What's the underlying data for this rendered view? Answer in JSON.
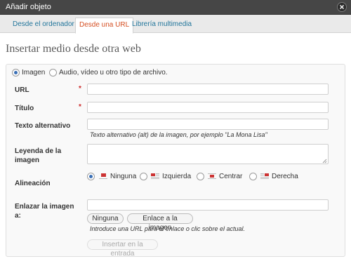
{
  "window": {
    "title": "Añadir objeto"
  },
  "tabs": [
    {
      "label": "Desde el ordenador",
      "active": false
    },
    {
      "label": "Desde una URL",
      "active": true
    },
    {
      "label": "Librería multimedia",
      "active": false
    }
  ],
  "heading": "Insertar medio desde otra web",
  "media_type": {
    "options": [
      "Imagen",
      "Audio, vídeo u otro tipo de archivo."
    ],
    "selected": "Imagen"
  },
  "fields": {
    "url": {
      "label": "URL",
      "required_mark": "*",
      "value": ""
    },
    "titulo": {
      "label": "Título",
      "required_mark": "*",
      "value": ""
    },
    "alt": {
      "label": "Texto alternativo",
      "value": "",
      "help": "Texto alternativo (alt) de la imagen, por ejemplo \"La Mona Lisa\""
    },
    "caption": {
      "label_line1": "Leyenda de la",
      "label_line2": "imagen",
      "value": ""
    },
    "align": {
      "label": "Alineación",
      "options": [
        "Ninguna",
        "Izquierda",
        "Centrar",
        "Derecha"
      ],
      "selected": "Ninguna"
    },
    "link": {
      "label_line1": "Enlazar la imagen",
      "label_line2": "a:",
      "value": "",
      "buttons": [
        "Ninguna",
        "Enlace a la imagen"
      ],
      "help": "Introduce una URL para el enlace o clic sobre el actual."
    }
  },
  "submit": {
    "label": "Insertar en la entrada",
    "enabled": false
  },
  "colors": {
    "accent_link": "#21759b",
    "active_tab": "#d54e21",
    "required": "#cc2a2a",
    "titlebar": "#464646"
  }
}
